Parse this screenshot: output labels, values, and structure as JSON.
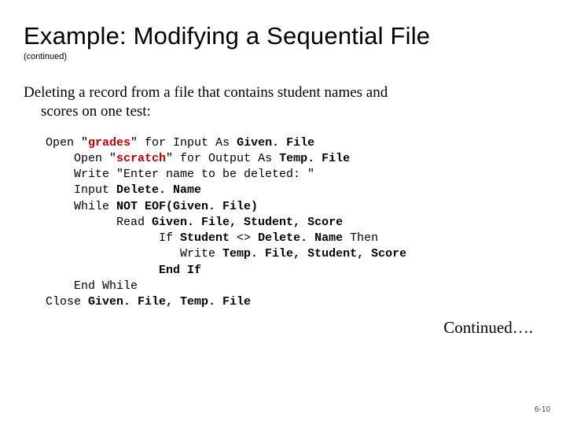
{
  "title": "Example: Modifying a Sequential File",
  "subtitle": "(continued)",
  "intro_line1": "Deleting a record from a file that contains student names and",
  "intro_line2": "scores on one test:",
  "continued": "Continued….",
  "pagenum": "6-10",
  "code": {
    "l01a": "Open ",
    "l01q": "\"",
    "l01s": "grades",
    "l01b": "\" for Input As ",
    "l01v": "Given. File",
    "l02a": "    Open ",
    "l02q": "\"",
    "l02s": "scratch",
    "l02b": "\" for Output As ",
    "l02v": "Temp. File",
    "l03a": "    Write ",
    "l03b": "\"Enter name to be deleted: \"",
    "l04a": "    Input ",
    "l04v": "Delete. Name",
    "l05a": "    While ",
    "l05v": "NOT EOF(Given. File)",
    "l06a": "          Read ",
    "l06v": "Given. File, Student, Score",
    "l07a": "                If ",
    "l07v1": "Student",
    "l07b": " <> ",
    "l07v2": "Delete. Name",
    "l07c": " Then",
    "l08a": "                   Write ",
    "l08v": "Temp. File, Student, Score",
    "l09a": "                ",
    "l09v": "End If",
    "l10a": "    End While",
    "l11a": "Close ",
    "l11v": "Given. File, Temp. File"
  }
}
